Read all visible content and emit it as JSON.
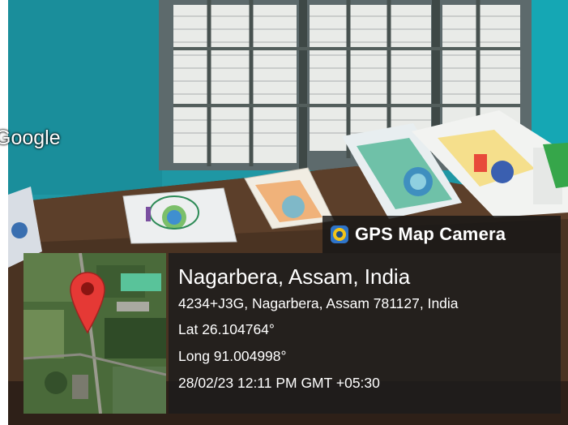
{
  "overlay": {
    "app_name": "GPS Map Camera",
    "app_icon": "camera-lens-icon",
    "location_title": "Nagarbera, Assam, India",
    "address": "4234+J3G, Nagarbera, Assam 781127, India",
    "latitude": "Lat 26.104764°",
    "longitude": "Long 91.004998°",
    "datetime": "28/02/23 12:11 PM GMT +05:30",
    "map_logo": "Google",
    "pin_icon": "map-pin-icon",
    "colors": {
      "wall": "#1f97a4",
      "table": "#4a3322",
      "pin": "#e53935",
      "panel": "#1c1c1c"
    }
  }
}
